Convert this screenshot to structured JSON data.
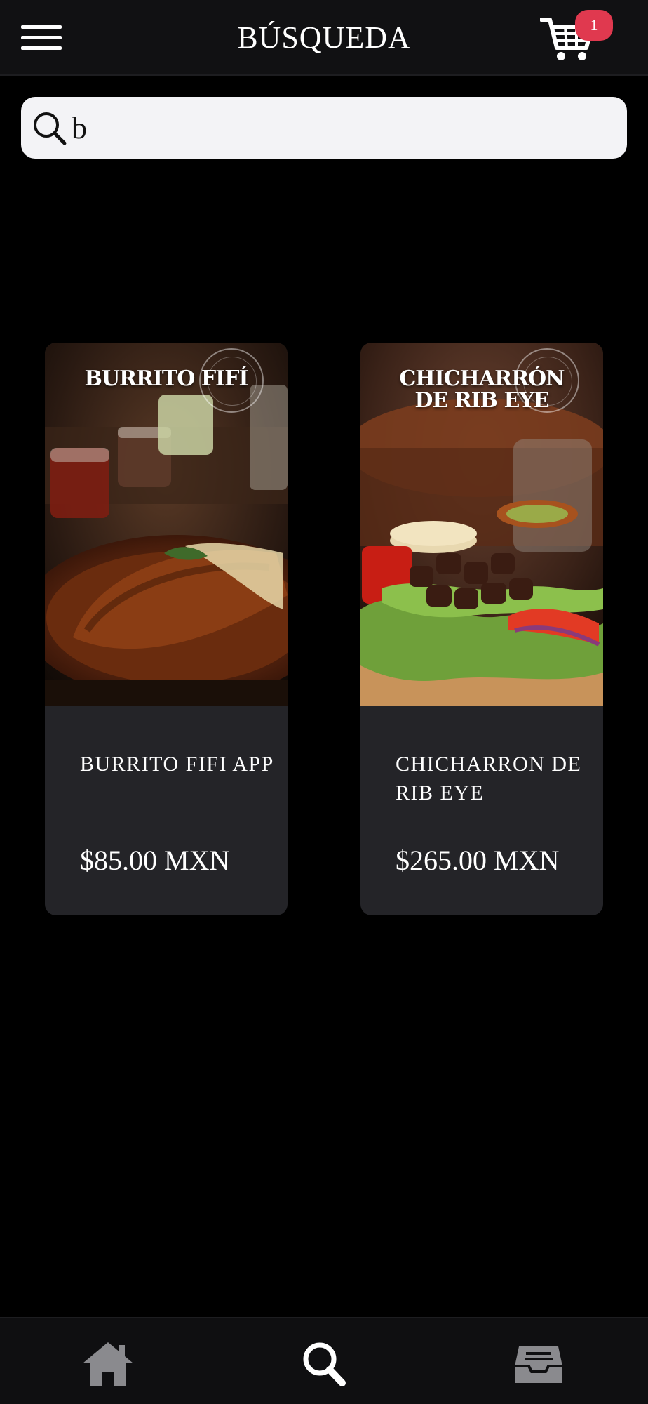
{
  "header": {
    "title": "BÚSQUEDA",
    "cart_count": "1",
    "menu_icon": "hamburger-menu-icon",
    "cart_icon": "shopping-cart-icon"
  },
  "search": {
    "value": "b",
    "icon": "search-icon"
  },
  "results": [
    {
      "image_title": "BURRITO FIFÍ",
      "name": "BURRITO FIFI APP",
      "price": "$85.00 MXN"
    },
    {
      "image_title": "CHICHARRÓN DE RIB EYE",
      "name": "CHICHARRON DE RIB EYE",
      "price": "$265.00 MXN"
    }
  ],
  "bottom_nav": {
    "items": [
      {
        "icon": "home-icon",
        "active": false
      },
      {
        "icon": "search-icon",
        "active": true
      },
      {
        "icon": "inbox-icon",
        "active": false
      }
    ]
  },
  "colors": {
    "background": "#000000",
    "header_bg": "#111113",
    "card_bg": "#242428",
    "badge": "#e0394f",
    "search_bg": "#f3f3f6",
    "nav_inactive": "#8a8a8e",
    "nav_active": "#ffffff"
  }
}
